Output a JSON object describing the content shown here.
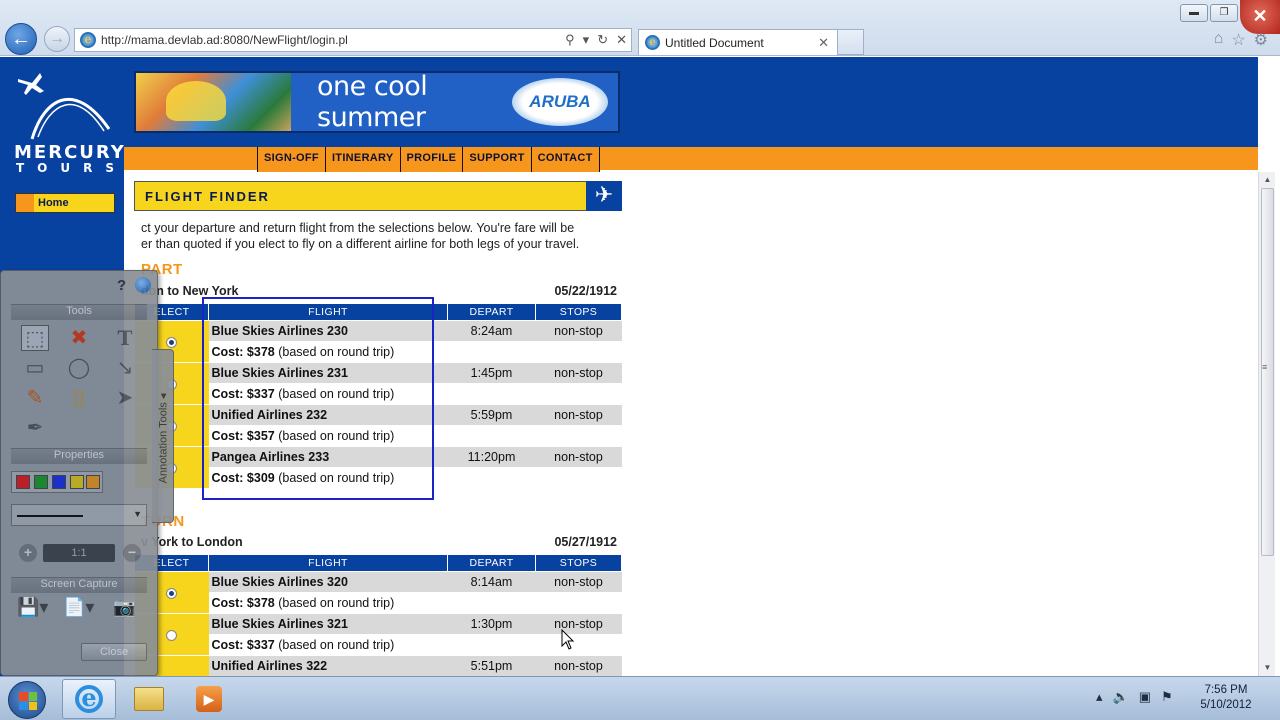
{
  "browser": {
    "url": "http://mama.devlab.ad:8080/NewFlight/login.pl",
    "tab_title": "Untitled Document",
    "back_icon": "back-arrow-icon",
    "forward_icon": "forward-arrow-icon",
    "window_controls": {
      "minimize": "▭",
      "restore": "🗗",
      "close": "✕"
    }
  },
  "site": {
    "logo_line1": "MERCURY",
    "logo_line2": "TOURS",
    "banner_slogan": "one cool summer",
    "banner_brand": "ARUBA",
    "menu": [
      "SIGN-OFF",
      "ITINERARY",
      "PROFILE",
      "SUPPORT",
      "CONTACT"
    ],
    "side_nav": [
      "Home"
    ]
  },
  "finder": {
    "title": "FLIGHT FINDER",
    "intro_line1": "ct your departure and return flight from the selections below. You're fare will be",
    "intro_line2": "er than quoted if you elect to fly on a different airline for both legs of your travel.",
    "columns": {
      "select": "ELECT",
      "flight": "FLIGHT",
      "depart": "DEPART",
      "stops": "STOPS"
    },
    "depart": {
      "heading": "PART",
      "route": "don to New York",
      "date": "05/22/1912",
      "flights": [
        {
          "name": "Blue Skies Airlines 230",
          "time": "8:24am",
          "stops": "non-stop",
          "cost": "$378",
          "note": "(based on round trip)",
          "selected": true
        },
        {
          "name": "Blue Skies Airlines 231",
          "time": "1:45pm",
          "stops": "non-stop",
          "cost": "$337",
          "note": "(based on round trip)",
          "selected": false
        },
        {
          "name": "Unified Airlines 232",
          "time": "5:59pm",
          "stops": "non-stop",
          "cost": "$357",
          "note": "(based on round trip)",
          "selected": false
        },
        {
          "name": "Pangea Airlines 233",
          "time": "11:20pm",
          "stops": "non-stop",
          "cost": "$309",
          "note": "(based on round trip)",
          "selected": false
        }
      ]
    },
    "return": {
      "heading": "TURN",
      "route": "v York to London",
      "date": "05/27/1912",
      "flights": [
        {
          "name": "Blue Skies Airlines 320",
          "time": "8:14am",
          "stops": "non-stop",
          "cost": "$378",
          "note": "(based on round trip)",
          "selected": true
        },
        {
          "name": "Blue Skies Airlines 321",
          "time": "1:30pm",
          "stops": "non-stop",
          "cost": "$337",
          "note": "(based on round trip)",
          "selected": false
        },
        {
          "name": "Unified Airlines 322",
          "time": "5:51pm",
          "stops": "non-stop",
          "cost": "",
          "note": "",
          "selected": false
        }
      ]
    }
  },
  "palette": {
    "tools_header": "Tools",
    "properties_header": "Properties",
    "capture_header": "Screen Capture",
    "zoom_value": "1:1",
    "close_label": "Close",
    "side_tab_label": "Annotation Tools",
    "colors": [
      "#c81e1e",
      "#1e8c2a",
      "#1e2fc8",
      "#c8b41e",
      "#d08a1e"
    ],
    "tool_icons": [
      "select-icon",
      "delete-icon",
      "text-icon",
      "rectangle-icon",
      "ellipse-icon",
      "arrow-icon",
      "highlighter-icon",
      "marker-icon",
      "pointer-icon",
      "eyedropper-icon"
    ]
  },
  "taskbar": {
    "time": "7:56 PM",
    "date": "5/10/2012"
  },
  "colors": {
    "site_blue": "#0842a0",
    "site_orange": "#f7961c",
    "site_yellow": "#f7d51c",
    "highlight": "#1b22c8"
  }
}
